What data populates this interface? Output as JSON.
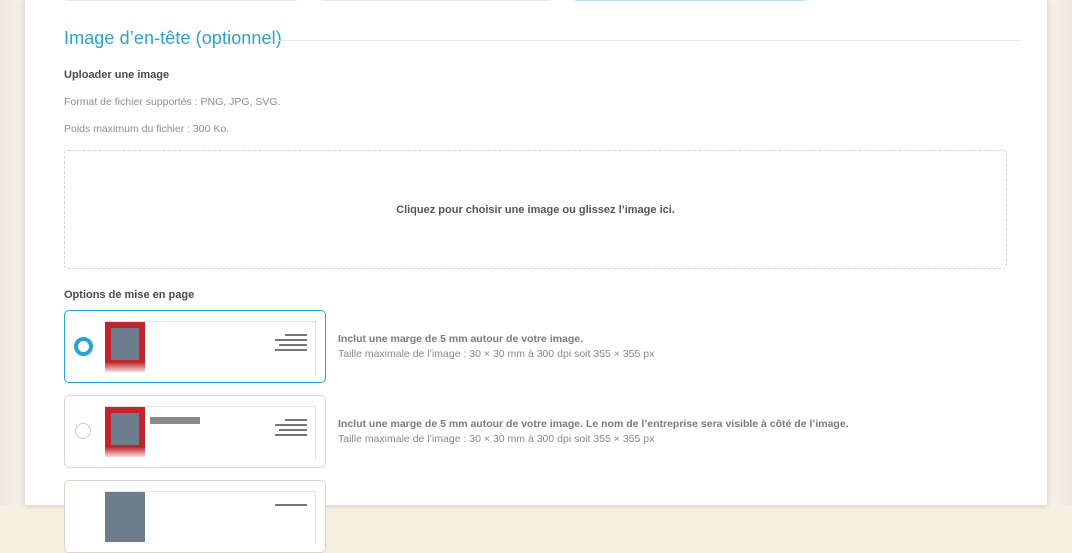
{
  "section": {
    "title": "Image d’en-tête (optionnel)"
  },
  "upload": {
    "label": "Uploader une image",
    "formats": "Format de fichier supportés : PNG, JPG, SVG.",
    "max_size": "Poids maximum du fichier : 300 Ko.",
    "dropzone_text": "Cliquez pour choisir une image ou glissez l’image ici."
  },
  "layout": {
    "label": "Options de mise en page",
    "options": [
      {
        "selected": true,
        "line1": "Inclut une marge de 5 mm autour de votre image.",
        "line2": "Taille maximale de l’image : 30 × 30 mm à 300 dpi soit 355 × 355 px"
      },
      {
        "selected": false,
        "line1": "Inclut une marge de 5 mm autour de votre image. Le nom de l’entreprise sera visible à côté de l’image.",
        "line2": "Taille maximale de l’image : 30 × 30 mm à 300 dpi soit 355 × 355 px"
      },
      {
        "selected": false,
        "line1": "",
        "line2": ""
      }
    ]
  },
  "colors": {
    "accent": "#28a3cf",
    "logo_red": "#c2242b",
    "logo_gray": "#6f7c8d"
  }
}
